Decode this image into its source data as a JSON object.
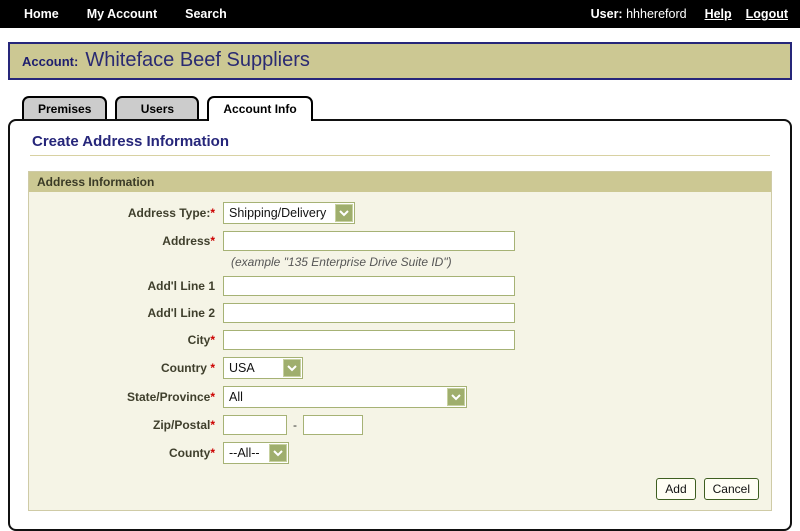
{
  "nav": {
    "items": [
      {
        "label": "Home"
      },
      {
        "label": "My Account"
      },
      {
        "label": "Search"
      }
    ],
    "user_label": "User:",
    "username": "hhhereford",
    "help_label": "Help",
    "logout_label": "Logout"
  },
  "header": {
    "account_label": "Account:",
    "account_name": "Whiteface Beef Suppliers"
  },
  "tabs": [
    {
      "label": "Premises",
      "active": false
    },
    {
      "label": "Users",
      "active": false
    },
    {
      "label": "Account Info",
      "active": true
    }
  ],
  "page": {
    "title": "Create Address Information"
  },
  "form": {
    "section_title": "Address Information",
    "required_marker": "*",
    "fields": {
      "address_type": {
        "label": "Address Type:",
        "value": "Shipping/Delivery"
      },
      "address": {
        "label": "Address",
        "value": "",
        "hint": "(example \"135 Enterprise Drive Suite ID\")"
      },
      "addl_line_1": {
        "label": "Add'l Line 1",
        "value": ""
      },
      "addl_line_2": {
        "label": "Add'l Line 2",
        "value": ""
      },
      "city": {
        "label": "City",
        "value": ""
      },
      "country": {
        "label": "Country ",
        "value": "USA"
      },
      "state_province": {
        "label": "State/Province",
        "value": "All"
      },
      "zip_postal": {
        "label": "Zip/Postal",
        "value1": "",
        "value2": "",
        "separator": "-"
      },
      "county": {
        "label": "County",
        "value": "--All--"
      }
    },
    "buttons": {
      "add": "Add",
      "cancel": "Cancel"
    }
  },
  "colors": {
    "nav_bg": "#000000",
    "khaki_accent": "#ccc893",
    "navy_text": "#26267a",
    "form_body_bg": "#f5f4e6",
    "input_border": "#a6b275",
    "dropdown_button": "#9fae6d",
    "required_red": "#cc0000",
    "button_border": "#3e5e20"
  }
}
